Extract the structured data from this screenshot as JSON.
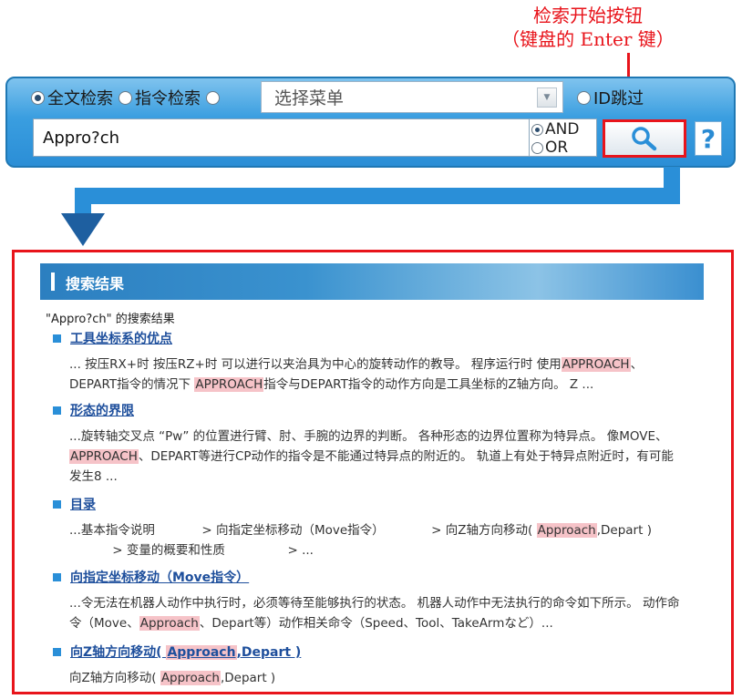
{
  "callout": {
    "line1": "检索开始按钮",
    "line2": "（键盘的 Enter 键）"
  },
  "search": {
    "option_fulltext": "全文检索",
    "option_command": "指令检索",
    "menu_placeholder": "选择菜单",
    "option_idskip": "ID跳过",
    "query": "Appro?ch",
    "logic_and": "AND",
    "logic_or": "OR",
    "help": "?"
  },
  "results": {
    "header": "搜索结果",
    "summary": "\"Appro?ch\" 的搜索结果",
    "hits": [
      {
        "title": "工具坐标系的优点",
        "snippet": [
          {
            "t": "... 按压RX+时 按压RZ+时 可以进行以夹治具为中心的旋转动作的教导。 程序运行时 使用"
          },
          {
            "h": "APPROACH"
          },
          {
            "t": "、\nDEPART指令的情况下 "
          },
          {
            "h": "APPROACH"
          },
          {
            "t": "指令与DEPART指令的动作方向是工具坐标的Z轴方向。 Z ..."
          }
        ]
      },
      {
        "title": "形态的界限",
        "snippet": [
          {
            "t": "...旋转轴交叉点 “Pw” 的位置进行臂、肘、手腕的边界的判断。 各种形态的边界位置称为特异点。 像MOVE、\n"
          },
          {
            "h": "APPROACH"
          },
          {
            "t": "、DEPART等进行CP动作的指令是不能通过特异点的附近的。 轨道上有处于特异点附近时，有可能\n发生8 ..."
          }
        ]
      },
      {
        "title": "目录",
        "snippet": [
          {
            "t": "...基本指令说明            > 向指定坐标移动（Move指令）            > 向Z轴方向移动( "
          },
          {
            "h": "Approach"
          },
          {
            "t": ",Depart )\n           > 变量的概要和性质                > ..."
          }
        ]
      },
      {
        "title": "向指定坐标移动（Move指令）",
        "snippet": [
          {
            "t": "...令无法在机器人动作中执行时，必须等待至能够执行的状态。 机器人动作中无法执行的命令如下所示。 动作命\n令（Move、"
          },
          {
            "h": "Approach"
          },
          {
            "t": "、Depart等）动作相关命令（Speed、Tool、TakeArmなど）..."
          }
        ]
      },
      {
        "title_parts": [
          {
            "t": "向Z轴方向移动( "
          },
          {
            "h": "Approach"
          },
          {
            "t": ",Depart )"
          }
        ],
        "snippet": [
          {
            "t": "向Z轴方向移动( "
          },
          {
            "h": "Approach"
          },
          {
            "t": ",Depart )"
          }
        ]
      }
    ]
  },
  "colors": {
    "accent_red": "#e8141b",
    "panel_blue": "#2b8ed6",
    "link_blue": "#1e4f9c",
    "highlight": "#f6c3c8"
  }
}
